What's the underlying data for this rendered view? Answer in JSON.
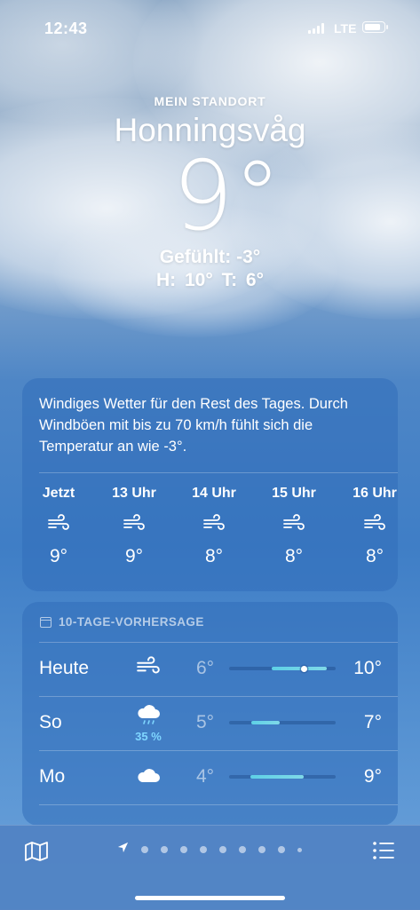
{
  "status_bar": {
    "time": "12:43",
    "network": "LTE"
  },
  "location": {
    "label": "MEIN STANDORT",
    "city": "Honningsvåg",
    "temperature": "9°",
    "feels_like": "Gefühlt: -3°",
    "high_low": "H: 10° T: 6°"
  },
  "summary_card": {
    "text": "Windiges Wetter für den Rest des Tages. Durch Windböen mit bis zu 70 km/h fühlt sich die Temperatur an wie -3°.",
    "hours": [
      {
        "label": "Jetzt",
        "icon": "wind-icon",
        "temp": "9°"
      },
      {
        "label": "13 Uhr",
        "icon": "wind-icon",
        "temp": "9°"
      },
      {
        "label": "14 Uhr",
        "icon": "wind-icon",
        "temp": "8°"
      },
      {
        "label": "15 Uhr",
        "icon": "wind-icon",
        "temp": "8°"
      },
      {
        "label": "16 Uhr",
        "icon": "wind-icon",
        "temp": "8°"
      }
    ]
  },
  "forecast": {
    "title": "10-TAGE-VORHERSAGE",
    "days": [
      {
        "day": "Heute",
        "icon": "wind-icon",
        "precip": "",
        "low": "6°",
        "high": "10°"
      },
      {
        "day": "So",
        "icon": "cloud-rain-icon",
        "precip": "35 %",
        "low": "5°",
        "high": "7°"
      },
      {
        "day": "Mo",
        "icon": "cloud-icon",
        "precip": "",
        "low": "4°",
        "high": "9°"
      }
    ]
  },
  "colors": {
    "accent_precip": "#7fd6ff",
    "temp_bar": "#5ed0e6"
  }
}
